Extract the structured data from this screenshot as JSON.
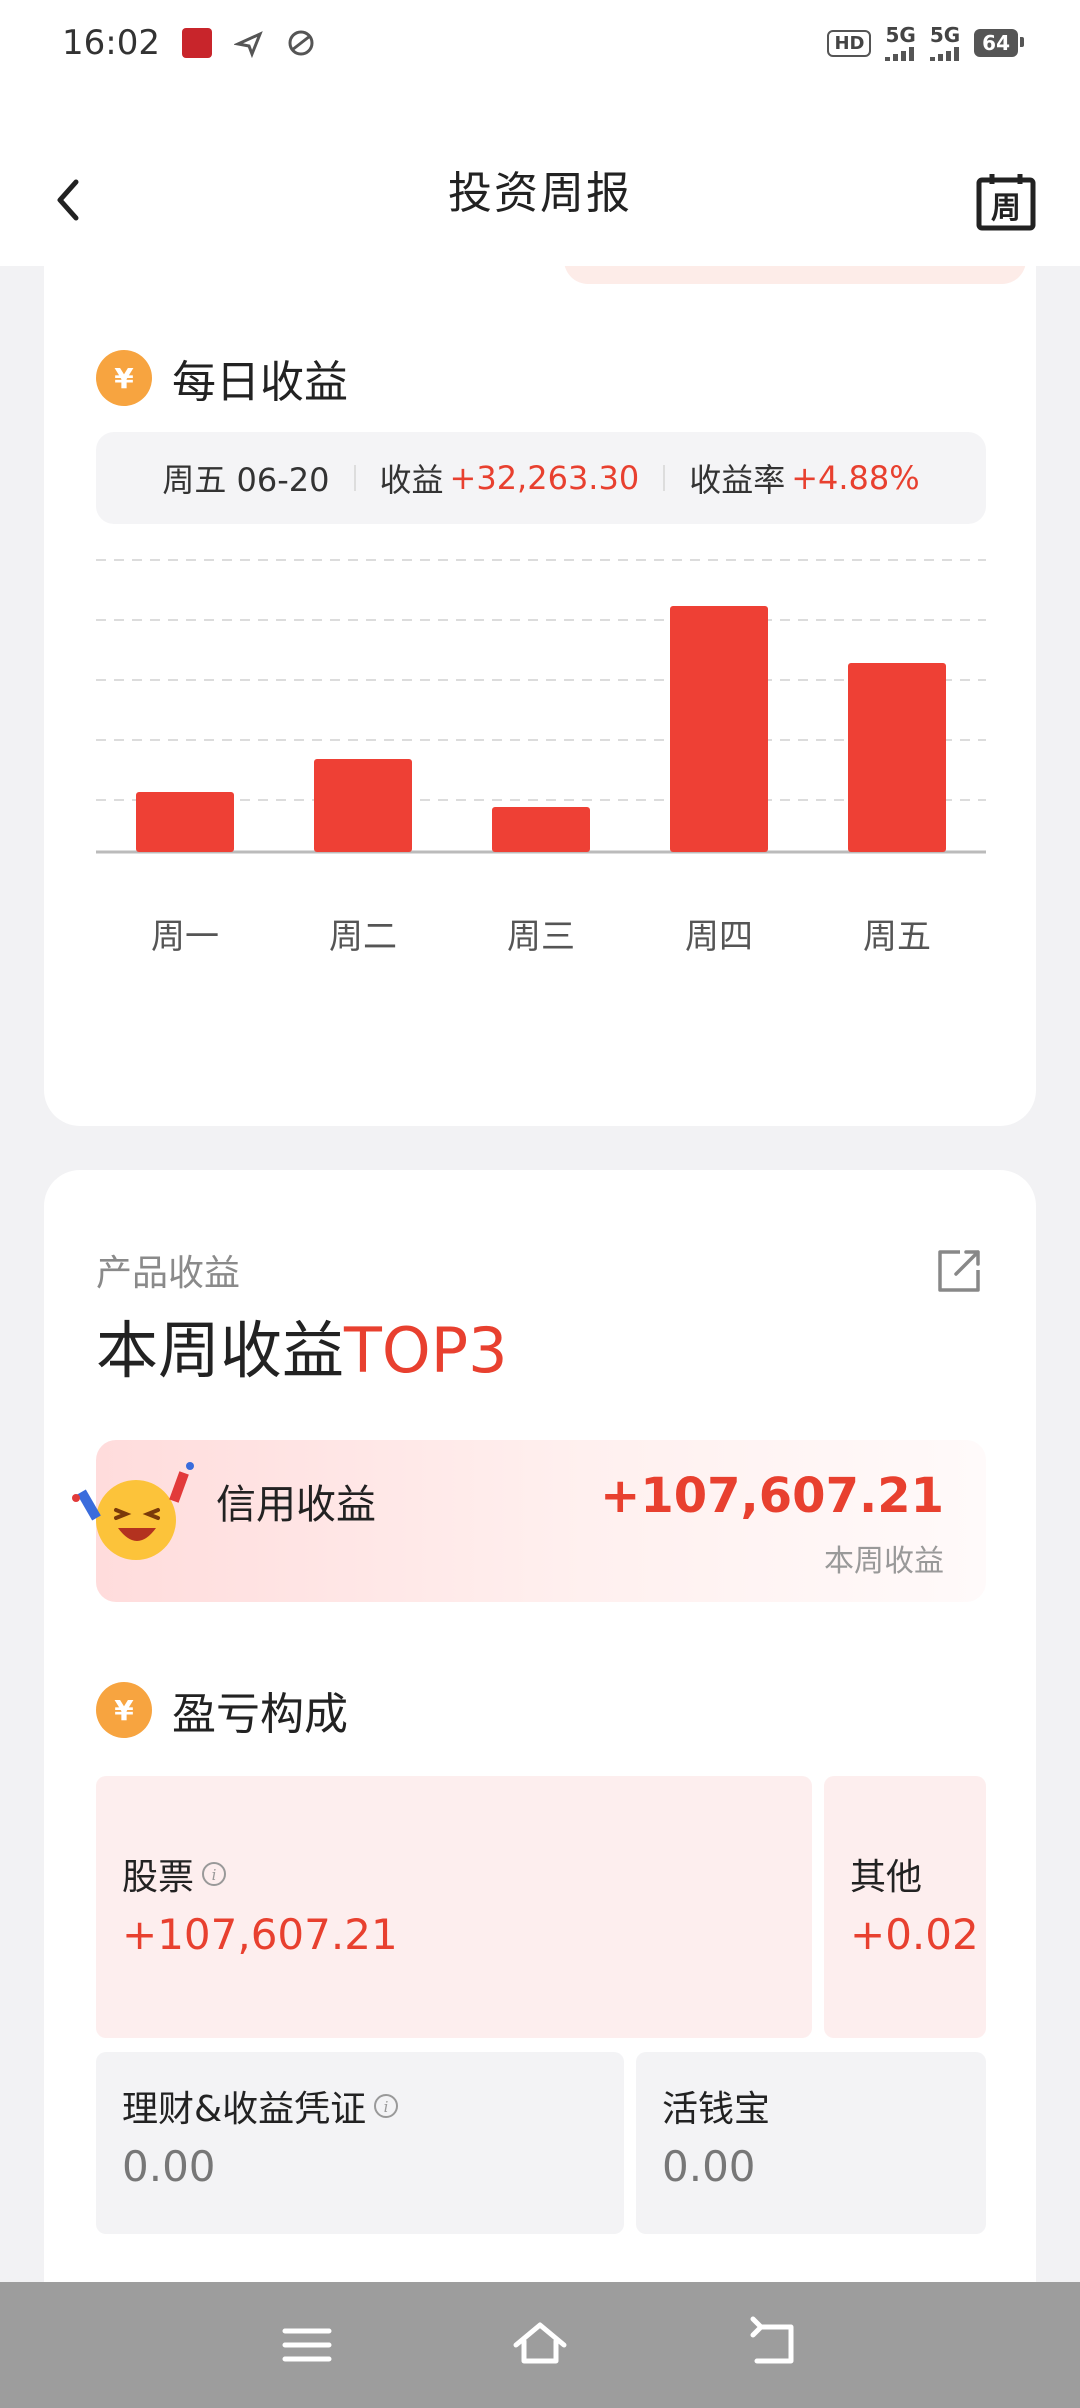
{
  "status": {
    "time": "16:02",
    "hd": "HD",
    "net1": "5G",
    "net2": "5G",
    "battery": "64"
  },
  "nav": {
    "title": "投资周报",
    "week_icon_label": "周"
  },
  "daily": {
    "title": "每日收益",
    "yen_symbol": "¥",
    "summary": {
      "day": "周五 06-20",
      "income_label": "收益",
      "income_value": "+32,263.30",
      "rate_label": "收益率",
      "rate_value": "+4.88%"
    }
  },
  "chart_data": {
    "type": "bar",
    "categories": [
      "周一",
      "周二",
      "周三",
      "周四",
      "周五"
    ],
    "values": [
      20,
      31,
      15,
      82,
      63
    ],
    "ylim": [
      0,
      100
    ],
    "gridlines": 5,
    "color": "#ee4035"
  },
  "product": {
    "subhead": "产品收益",
    "title_main": "本周收益",
    "title_accent": "TOP3",
    "top_item": {
      "name": "信用收益",
      "value": "+107,607.21",
      "caption": "本周收益"
    }
  },
  "breakdown": {
    "title": "盈亏构成",
    "yen_symbol": "¥",
    "tiles": {
      "stock": {
        "label": "股票",
        "value": "+107,607.21"
      },
      "other": {
        "label": "其他",
        "value": "+0.02"
      },
      "wealth": {
        "label": "理财&收益凭证",
        "value": "0.00"
      },
      "cash": {
        "label": "活钱宝",
        "value": "0.00"
      }
    }
  },
  "colors": {
    "accent_red": "#e8402f",
    "yen_orange": "#f7a440"
  }
}
